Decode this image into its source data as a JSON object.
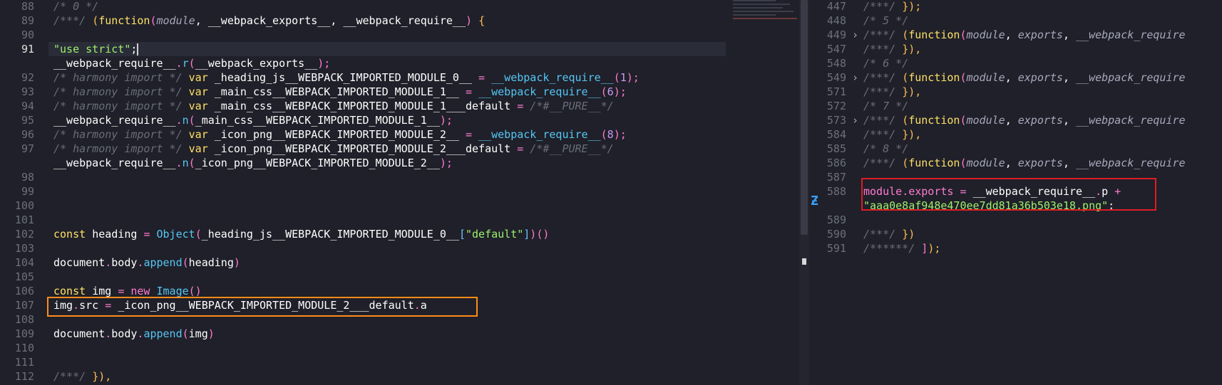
{
  "left": {
    "lines": [
      {
        "no": "88",
        "segs": [
          [
            "/* 0 */",
            "cm"
          ]
        ]
      },
      {
        "no": "89",
        "segs": [
          [
            "/***/ ",
            "cm"
          ],
          [
            "(",
            "par"
          ],
          [
            "function",
            "kw"
          ],
          [
            "(",
            "par2"
          ],
          [
            "module",
            "pr"
          ],
          [
            ", ",
            "var"
          ],
          [
            "__webpack_exports__",
            "var"
          ],
          [
            ", ",
            "var"
          ],
          [
            "__webpack_require__",
            "var"
          ],
          [
            ")",
            "par2"
          ],
          [
            " ",
            "var"
          ],
          [
            "{",
            "par"
          ]
        ]
      },
      {
        "no": "90",
        "segs": []
      },
      {
        "no": "91",
        "segs": [
          [
            "\"use strict\"",
            "str"
          ],
          [
            ";",
            "var"
          ]
        ],
        "active": true
      },
      {
        "no": "",
        "segs": [
          [
            "__webpack_require__",
            "var"
          ],
          [
            ".",
            "op"
          ],
          [
            "r",
            "fn"
          ],
          [
            "(",
            "par2"
          ],
          [
            "__webpack_exports__",
            "var"
          ],
          [
            ");",
            "par2"
          ]
        ]
      },
      {
        "no": "92",
        "segs": [
          [
            "/* harmony import */ ",
            "cm"
          ],
          [
            "var ",
            "kw"
          ],
          [
            "_heading_js__WEBPACK_IMPORTED_MODULE_0__ ",
            "var"
          ],
          [
            "= ",
            "op"
          ],
          [
            "__webpack_require__",
            "fn"
          ],
          [
            "(",
            "par2"
          ],
          [
            "1",
            "num"
          ],
          [
            ");",
            "par2"
          ]
        ]
      },
      {
        "no": "93",
        "segs": [
          [
            "/* harmony import */ ",
            "cm"
          ],
          [
            "var ",
            "kw"
          ],
          [
            "_main_css__WEBPACK_IMPORTED_MODULE_1__ ",
            "var"
          ],
          [
            "= ",
            "op"
          ],
          [
            "__webpack_require__",
            "fn"
          ],
          [
            "(",
            "par2"
          ],
          [
            "6",
            "num"
          ],
          [
            ");",
            "par2"
          ]
        ]
      },
      {
        "no": "94",
        "segs": [
          [
            "/* harmony import */ ",
            "cm"
          ],
          [
            "var ",
            "kw"
          ],
          [
            "_main_css__WEBPACK_IMPORTED_MODULE_1___default ",
            "var"
          ],
          [
            "= ",
            "op"
          ],
          [
            "/*#__PURE__*/",
            "cm"
          ]
        ]
      },
      {
        "no": "95",
        "segs": [
          [
            "__webpack_require__",
            "var"
          ],
          [
            ".",
            "op"
          ],
          [
            "n",
            "fn"
          ],
          [
            "(",
            "par2"
          ],
          [
            "_main_css__WEBPACK_IMPORTED_MODULE_1__",
            "var"
          ],
          [
            ");",
            "par2"
          ]
        ]
      },
      {
        "no": "96",
        "segs": [
          [
            "/* harmony import */ ",
            "cm"
          ],
          [
            "var ",
            "kw"
          ],
          [
            "_icon_png__WEBPACK_IMPORTED_MODULE_2__ ",
            "var"
          ],
          [
            "= ",
            "op"
          ],
          [
            "__webpack_require__",
            "fn"
          ],
          [
            "(",
            "par2"
          ],
          [
            "8",
            "num"
          ],
          [
            ");",
            "par2"
          ]
        ]
      },
      {
        "no": "97",
        "segs": [
          [
            "/* harmony import */ ",
            "cm"
          ],
          [
            "var ",
            "kw"
          ],
          [
            "_icon_png__WEBPACK_IMPORTED_MODULE_2___default ",
            "var"
          ],
          [
            "= ",
            "op"
          ],
          [
            "/*#__PURE__*/",
            "cm"
          ]
        ]
      },
      {
        "no": "",
        "segs": [
          [
            "__webpack_require__",
            "var"
          ],
          [
            ".",
            "op"
          ],
          [
            "n",
            "fn"
          ],
          [
            "(",
            "par2"
          ],
          [
            "_icon_png__WEBPACK_IMPORTED_MODULE_2__",
            "var"
          ],
          [
            ");",
            "par2"
          ]
        ]
      },
      {
        "no": "98",
        "segs": []
      },
      {
        "no": "99",
        "segs": []
      },
      {
        "no": "100",
        "segs": []
      },
      {
        "no": "101",
        "segs": []
      },
      {
        "no": "102",
        "segs": [
          [
            "const ",
            "kw"
          ],
          [
            "heading ",
            "var"
          ],
          [
            "= ",
            "op"
          ],
          [
            "Object",
            "fn"
          ],
          [
            "(",
            "par2"
          ],
          [
            "_heading_js__WEBPACK_IMPORTED_MODULE_0__",
            "var"
          ],
          [
            "[",
            "paren3"
          ],
          [
            "\"default\"",
            "str"
          ],
          [
            "]",
            "paren3"
          ],
          [
            ")",
            "par2"
          ],
          [
            "()",
            "par2"
          ]
        ]
      },
      {
        "no": "103",
        "segs": []
      },
      {
        "no": "104",
        "segs": [
          [
            "document",
            "var"
          ],
          [
            ".",
            "op"
          ],
          [
            "body",
            "var"
          ],
          [
            ".",
            "op"
          ],
          [
            "append",
            "fn"
          ],
          [
            "(",
            "par2"
          ],
          [
            "heading",
            "var"
          ],
          [
            ")",
            "par2"
          ]
        ]
      },
      {
        "no": "105",
        "segs": []
      },
      {
        "no": "106",
        "segs": [
          [
            "const ",
            "kw"
          ],
          [
            "img ",
            "var"
          ],
          [
            "= ",
            "op"
          ],
          [
            "new ",
            "kw2"
          ],
          [
            "Image",
            "fn"
          ],
          [
            "()",
            "par2"
          ]
        ]
      },
      {
        "no": "107",
        "segs": [
          [
            "img",
            "var"
          ],
          [
            ".",
            "op"
          ],
          [
            "src ",
            "var"
          ],
          [
            "= ",
            "op"
          ],
          [
            "_icon_png__WEBPACK_IMPORTED_MODULE_2___default",
            "var"
          ],
          [
            ".",
            "op"
          ],
          [
            "a",
            "var"
          ]
        ]
      },
      {
        "no": "108",
        "segs": []
      },
      {
        "no": "109",
        "segs": [
          [
            "document",
            "var"
          ],
          [
            ".",
            "op"
          ],
          [
            "body",
            "var"
          ],
          [
            ".",
            "op"
          ],
          [
            "append",
            "fn"
          ],
          [
            "(",
            "par2"
          ],
          [
            "img",
            "var"
          ],
          [
            ")",
            "par2"
          ]
        ]
      },
      {
        "no": "110",
        "segs": []
      },
      {
        "no": "111",
        "segs": []
      },
      {
        "no": "112",
        "segs": [
          [
            "/***/ ",
            "cm"
          ],
          [
            "}",
            "par"
          ],
          [
            "),",
            "par"
          ]
        ]
      }
    ]
  },
  "right": {
    "lines": [
      {
        "no": "447",
        "segs": [
          [
            "/***/ ",
            "cm"
          ],
          [
            "}",
            "par"
          ],
          [
            ");",
            "par"
          ]
        ]
      },
      {
        "no": "448",
        "segs": [
          [
            "/* 5 */",
            "cm"
          ]
        ]
      },
      {
        "no": "449",
        "fold": "›",
        "segs": [
          [
            "/***/ ",
            "cm"
          ],
          [
            "(",
            "par"
          ],
          [
            "function",
            "kw"
          ],
          [
            "(",
            "par2"
          ],
          [
            "module",
            "pr"
          ],
          [
            ", ",
            "var"
          ],
          [
            "exports",
            "pr"
          ],
          [
            ", ",
            "var"
          ],
          [
            "__webpack_require",
            "pr"
          ]
        ]
      },
      {
        "no": "547",
        "segs": [
          [
            "/***/ ",
            "cm"
          ],
          [
            "}",
            "par"
          ],
          [
            "),",
            "par"
          ]
        ]
      },
      {
        "no": "548",
        "segs": [
          [
            "/* 6 */",
            "cm"
          ]
        ]
      },
      {
        "no": "549",
        "fold": "›",
        "segs": [
          [
            "/***/ ",
            "cm"
          ],
          [
            "(",
            "par"
          ],
          [
            "function",
            "kw"
          ],
          [
            "(",
            "par2"
          ],
          [
            "module",
            "pr"
          ],
          [
            ", ",
            "var"
          ],
          [
            "exports",
            "pr"
          ],
          [
            ", ",
            "var"
          ],
          [
            "__webpack_require",
            "pr"
          ]
        ]
      },
      {
        "no": "571",
        "segs": [
          [
            "/***/ ",
            "cm"
          ],
          [
            "}",
            "par"
          ],
          [
            "),",
            "par"
          ]
        ]
      },
      {
        "no": "572",
        "segs": [
          [
            "/* 7 */",
            "cm"
          ]
        ]
      },
      {
        "no": "573",
        "fold": "›",
        "segs": [
          [
            "/***/ ",
            "cm"
          ],
          [
            "(",
            "par"
          ],
          [
            "function",
            "kw"
          ],
          [
            "(",
            "par2"
          ],
          [
            "module",
            "pr"
          ],
          [
            ", ",
            "var"
          ],
          [
            "exports",
            "pr"
          ],
          [
            ", ",
            "var"
          ],
          [
            "__webpack_require",
            "pr"
          ]
        ]
      },
      {
        "no": "584",
        "segs": [
          [
            "/***/ ",
            "cm"
          ],
          [
            "}",
            "par"
          ],
          [
            "),",
            "par"
          ]
        ]
      },
      {
        "no": "585",
        "segs": [
          [
            "/* 8 */",
            "cm"
          ]
        ]
      },
      {
        "no": "586",
        "segs": [
          [
            "/***/ ",
            "cm"
          ],
          [
            "(",
            "par"
          ],
          [
            "function",
            "kw"
          ],
          [
            "(",
            "par2"
          ],
          [
            "module",
            "pr"
          ],
          [
            ", ",
            "var"
          ],
          [
            "exports",
            "pr"
          ],
          [
            ", ",
            "var"
          ],
          [
            "__webpack_require",
            "pr"
          ]
        ]
      },
      {
        "no": "587",
        "segs": []
      },
      {
        "no": "588",
        "segs": [
          [
            "module",
            "kw2"
          ],
          [
            ".",
            "op"
          ],
          [
            "exports ",
            "kw2"
          ],
          [
            "= ",
            "op"
          ],
          [
            "__webpack_require__",
            "var"
          ],
          [
            ".",
            "op"
          ],
          [
            "p ",
            "var"
          ],
          [
            "+",
            "op"
          ]
        ]
      },
      {
        "no": "",
        "segs": [
          [
            "\"aaa0e8af948e470ee7dd81a36b503e18.png\"",
            "str"
          ],
          [
            ";",
            "var"
          ]
        ]
      },
      {
        "no": "589",
        "segs": []
      },
      {
        "no": "590",
        "segs": [
          [
            "/***/ ",
            "cm"
          ],
          [
            "}",
            "par"
          ],
          [
            ")",
            "par"
          ]
        ]
      },
      {
        "no": "591",
        "segs": [
          [
            "/******/ ",
            "cm"
          ],
          [
            "]",
            "par2"
          ],
          [
            ");",
            "par"
          ]
        ]
      }
    ]
  },
  "colors": {
    "background": "#1f2029",
    "highlight_orange": "#ff8c1a",
    "highlight_red": "#e01b24"
  }
}
